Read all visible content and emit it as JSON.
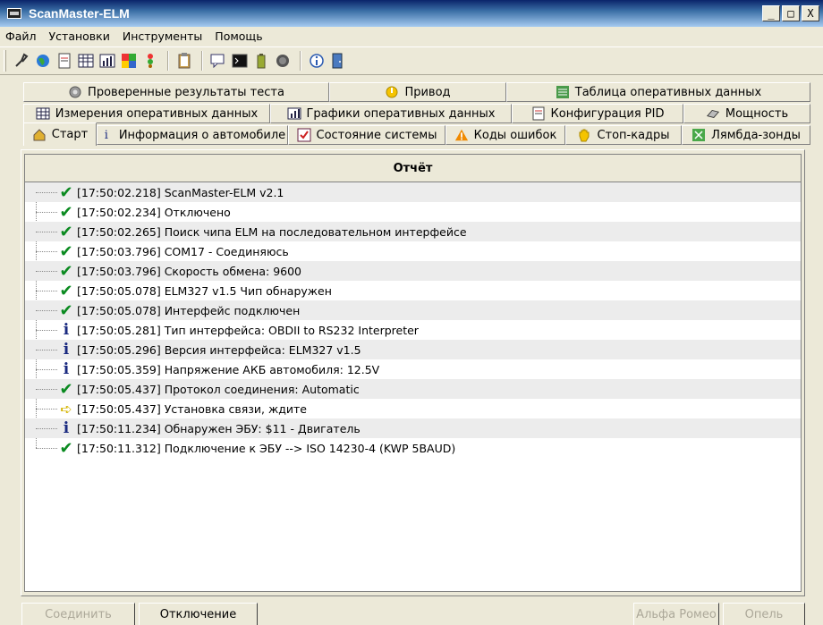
{
  "window": {
    "title": "ScanMaster-ELM",
    "controls": {
      "minimize": "_",
      "maximize": "□",
      "close": "X"
    }
  },
  "menu": [
    "Файл",
    "Установки",
    "Инструменты",
    "Помощь"
  ],
  "tabs": {
    "row1": [
      {
        "label": "Проверенные результаты теста",
        "icon": "gear-icon"
      },
      {
        "label": "Привод",
        "icon": "power-icon"
      },
      {
        "label": "Таблица оперативных данных",
        "icon": "table-icon"
      }
    ],
    "row2": [
      {
        "label": "Измерения оперативных данных",
        "icon": "grid-icon"
      },
      {
        "label": "Графики оперативных данных",
        "icon": "chart-icon"
      },
      {
        "label": "Конфигурация PID",
        "icon": "document-icon"
      },
      {
        "label": "Мощность",
        "icon": "engine-icon"
      }
    ],
    "row3": [
      {
        "label": "Старт",
        "icon": "home-icon"
      },
      {
        "label": "Информация о автомобиле",
        "icon": "info-icon"
      },
      {
        "label": "Состояние системы",
        "icon": "checklist-icon"
      },
      {
        "label": "Коды ошибок",
        "icon": "warning-icon"
      },
      {
        "label": "Стоп-кадры",
        "icon": "hand-icon"
      },
      {
        "label": "Лямбда-зонды",
        "icon": "sensor-icon"
      }
    ]
  },
  "report": {
    "header": "Отчёт",
    "entries": [
      {
        "status": "ok",
        "text": "[17:50:02.218] ScanMaster-ELM v2.1"
      },
      {
        "status": "ok",
        "text": "[17:50:02.234] Отключено"
      },
      {
        "status": "ok",
        "text": "[17:50:02.265] Поиск чипа ELM на последовательном интерфейсе"
      },
      {
        "status": "ok",
        "text": "[17:50:03.796] COM17 - Соединяюсь"
      },
      {
        "status": "ok",
        "text": "[17:50:03.796] Скорость обмена: 9600"
      },
      {
        "status": "ok",
        "text": "[17:50:05.078] ELM327 v1.5 Чип обнаружен"
      },
      {
        "status": "ok",
        "text": "[17:50:05.078] Интерфейс подключен"
      },
      {
        "status": "info",
        "text": "[17:50:05.281] Тип интерфейса: OBDII to RS232 Interpreter"
      },
      {
        "status": "info",
        "text": "[17:50:05.296] Версия интерфейса: ELM327 v1.5"
      },
      {
        "status": "info",
        "text": "[17:50:05.359] Напряжение АКБ автомобиля: 12.5V"
      },
      {
        "status": "ok",
        "text": "[17:50:05.437] Протокол соединения: Automatic"
      },
      {
        "status": "arrow",
        "text": "[17:50:05.437] Установка связи, ждите"
      },
      {
        "status": "info",
        "text": "[17:50:11.234] Обнаружен ЭБУ: $11 - Двигатель"
      },
      {
        "status": "ok",
        "text": "[17:50:11.312] Подключение к ЭБУ --> ISO 14230-4 (KWP 5BAUD)"
      }
    ]
  },
  "buttons": {
    "connect": "Соединить",
    "disconnect": "Отключение",
    "brand": "Альфа Ромео",
    "model": "Опель"
  }
}
